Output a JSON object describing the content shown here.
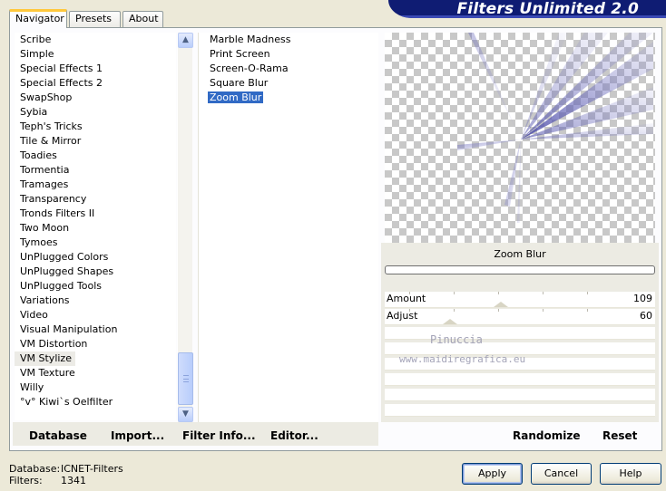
{
  "banner": {
    "title": "Filters Unlimited 2.0"
  },
  "tabs": [
    {
      "label": "Navigator"
    },
    {
      "label": "Presets"
    },
    {
      "label": "About"
    }
  ],
  "categories": [
    "Scribe",
    "Simple",
    "Special Effects 1",
    "Special Effects 2",
    "SwapShop",
    "Sybia",
    "Teph's Tricks",
    "Tile & Mirror",
    "Toadies",
    "Tormentia",
    "Tramages",
    "Transparency",
    "Tronds Filters II",
    "Two Moon",
    "Tymoes",
    "UnPlugged Colors",
    "UnPlugged Shapes",
    "UnPlugged Tools",
    "Variations",
    "Video",
    "Visual Manipulation",
    "VM Distortion",
    "VM Stylize",
    "VM Texture",
    "Willy",
    "°v° Kiwi`s Oelfilter"
  ],
  "selected_category": "VM Stylize",
  "filters": [
    "Marble Madness",
    "Print Screen",
    "Screen-O-Rama",
    "Square Blur",
    "Zoom Blur"
  ],
  "selected_filter": "Zoom Blur",
  "preview": {
    "filter_name": "Zoom Blur"
  },
  "progress_fraction": 0,
  "sliders": [
    {
      "label": "Amount",
      "value": "109",
      "fraction": 0.43
    },
    {
      "label": "Adjust",
      "value": "60",
      "fraction": 0.24
    }
  ],
  "watermark": {
    "line1": "Pinuccia",
    "line2": "www.maidiregrafica.eu"
  },
  "toolbar": {
    "database": "Database",
    "import": "Import...",
    "filter_info": "Filter Info...",
    "editor": "Editor...",
    "randomize": "Randomize",
    "reset": "Reset"
  },
  "status": {
    "database_label": "Database:",
    "database_value": "ICNET-Filters",
    "filters_label": "Filters:",
    "filters_value": "1341"
  },
  "buttons": {
    "apply": "Apply",
    "cancel": "Cancel",
    "help": "Help"
  },
  "colors": {
    "banner": "#0f1c73",
    "selection": "#316ac5",
    "accent_tab": "#ffc83c"
  }
}
